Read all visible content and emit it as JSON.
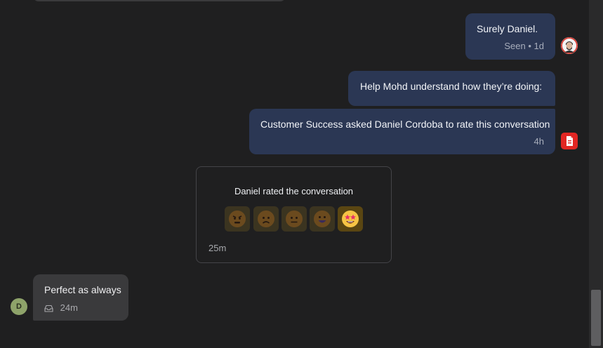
{
  "messages": [
    {
      "text": "Surely Daniel.",
      "meta": "Seen • 1d"
    },
    {
      "text": "Help Mohd understand how they’re doing:"
    },
    {
      "text": "Customer Success asked Daniel Cordoba to rate this conversation",
      "meta": "4h"
    }
  ],
  "rating": {
    "title": "Daniel rated the conversation",
    "time": "25m",
    "options": [
      "angry",
      "sad",
      "neutral",
      "happy",
      "star-struck"
    ],
    "selected_index": 4
  },
  "incoming": {
    "text": "Perfect as always",
    "time": "24m",
    "channel_icon": "inbox-icon",
    "avatar_initial": "D"
  },
  "colors": {
    "outgoing_bubble": "#2b3754",
    "incoming_bubble": "#3a3a3c",
    "background": "#1f1f20",
    "doc_badge": "#e22623"
  }
}
